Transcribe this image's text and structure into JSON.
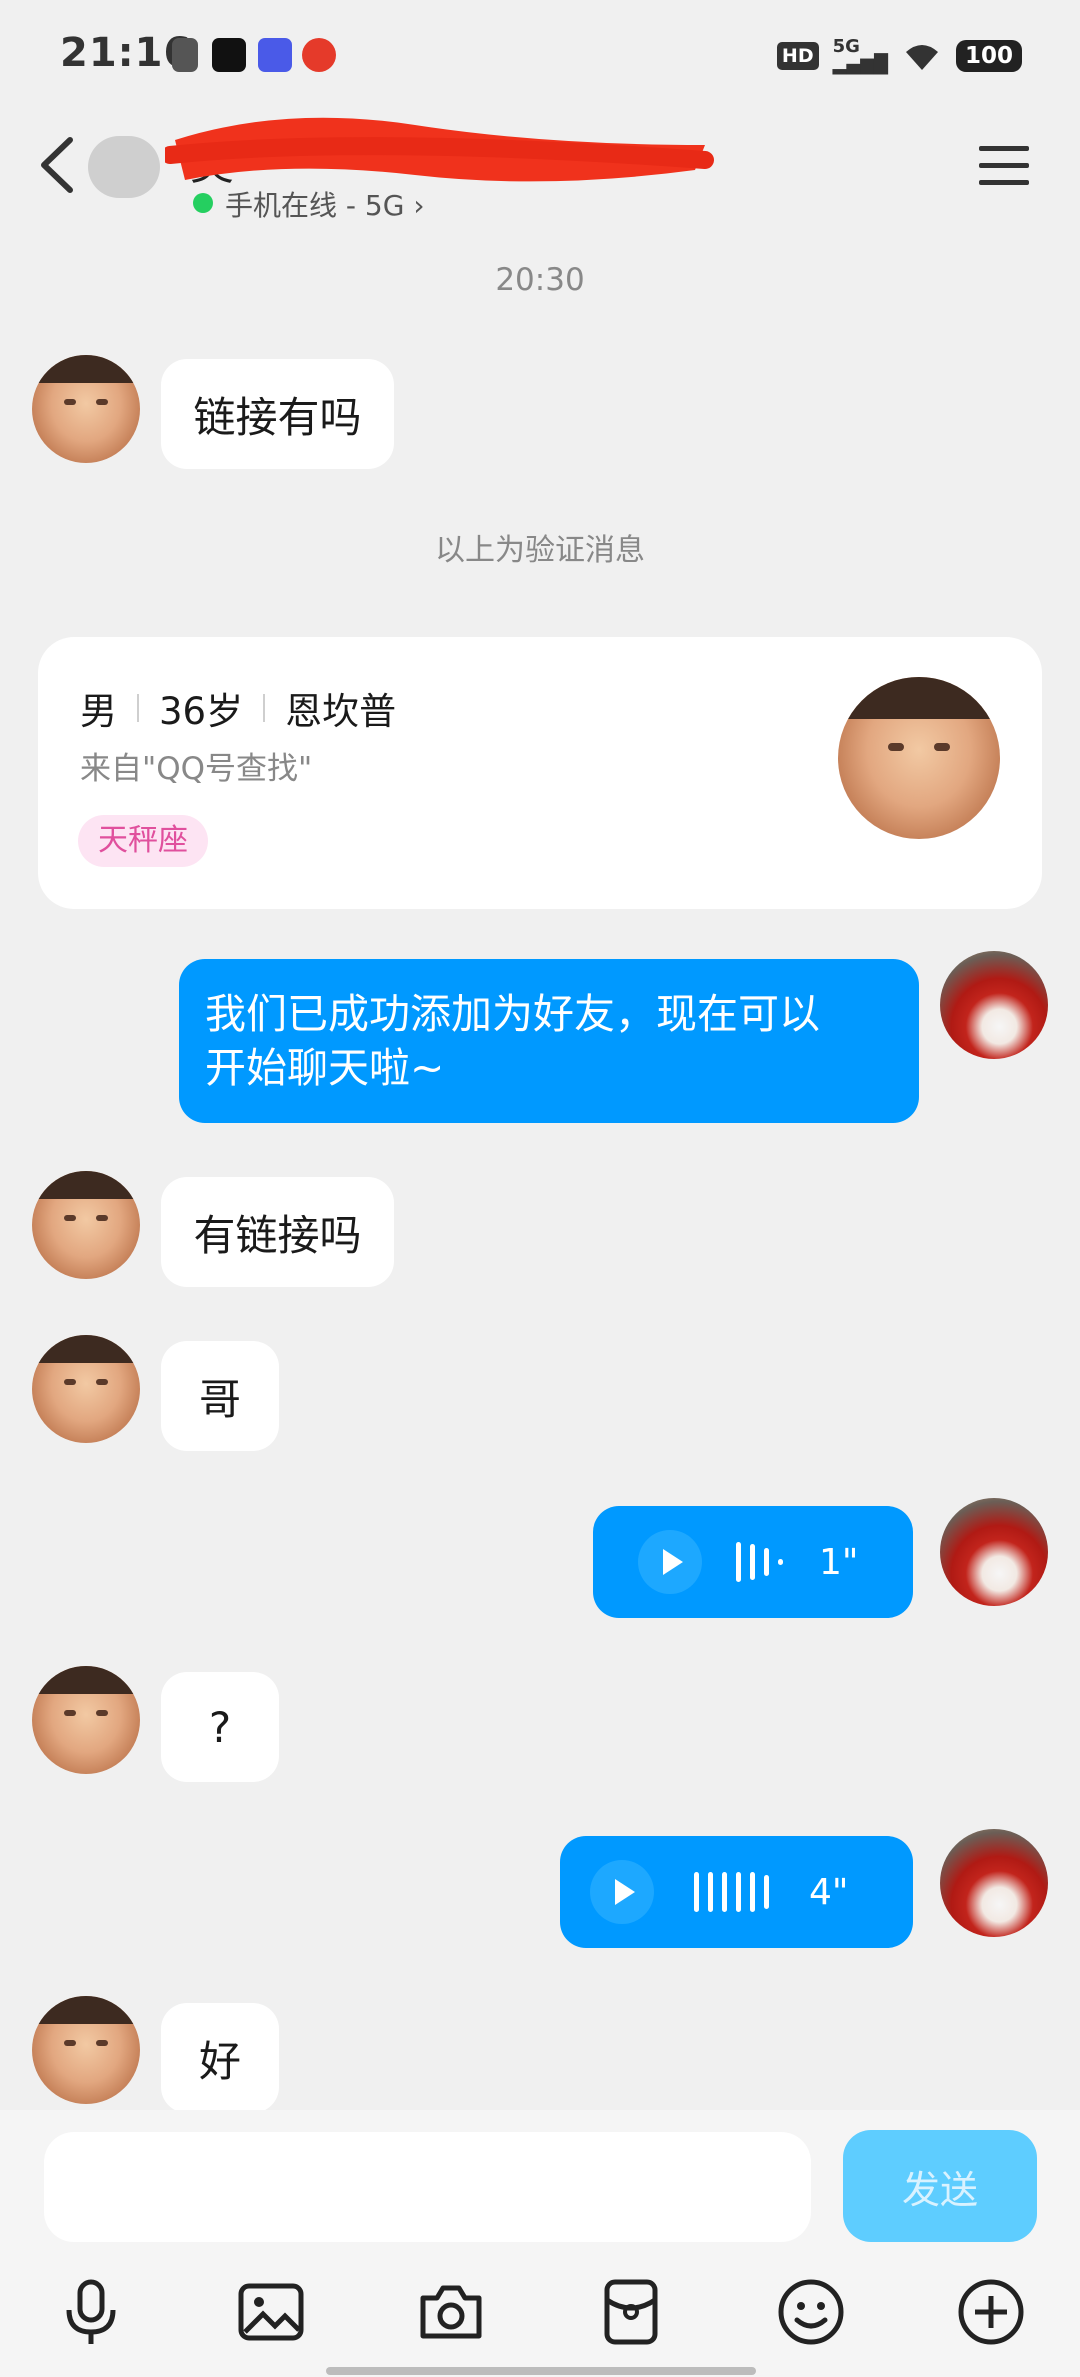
{
  "status_bar": {
    "time": "21:16",
    "hd": "HD",
    "network": "5G",
    "battery": "100"
  },
  "header": {
    "contact_name": "美",
    "online_status": "手机在线 - 5G"
  },
  "timestamp": "20:30",
  "verify_notice": "以上为验证消息",
  "messages": [
    {
      "side": "in",
      "text": "链接有吗"
    },
    {
      "side": "out",
      "text_line1": "我们已成功添加为好友，现在可以",
      "text_line2": "开始聊天啦~"
    },
    {
      "side": "in",
      "text": "有链接吗"
    },
    {
      "side": "in",
      "text": "哥"
    },
    {
      "side": "out",
      "type": "voice",
      "duration": "1\""
    },
    {
      "side": "in",
      "text": "?"
    },
    {
      "side": "out",
      "type": "voice",
      "duration": "4\""
    },
    {
      "side": "in",
      "text": "好"
    }
  ],
  "profile_card": {
    "gender": "男",
    "age": "36岁",
    "location": "恩坎普",
    "source": "来自\"QQ号查找\"",
    "tag": "天秤座"
  },
  "input": {
    "placeholder": "",
    "send_label": "发送"
  },
  "toolbar_icons": [
    "mic-icon",
    "image-icon",
    "camera-icon",
    "red-packet-icon",
    "emoji-icon",
    "plus-icon"
  ],
  "colors": {
    "outgoing_bubble": "#0099ff",
    "send_button": "#5ecdff",
    "online_dot": "#25cf60",
    "tag_text": "#e0509d"
  }
}
